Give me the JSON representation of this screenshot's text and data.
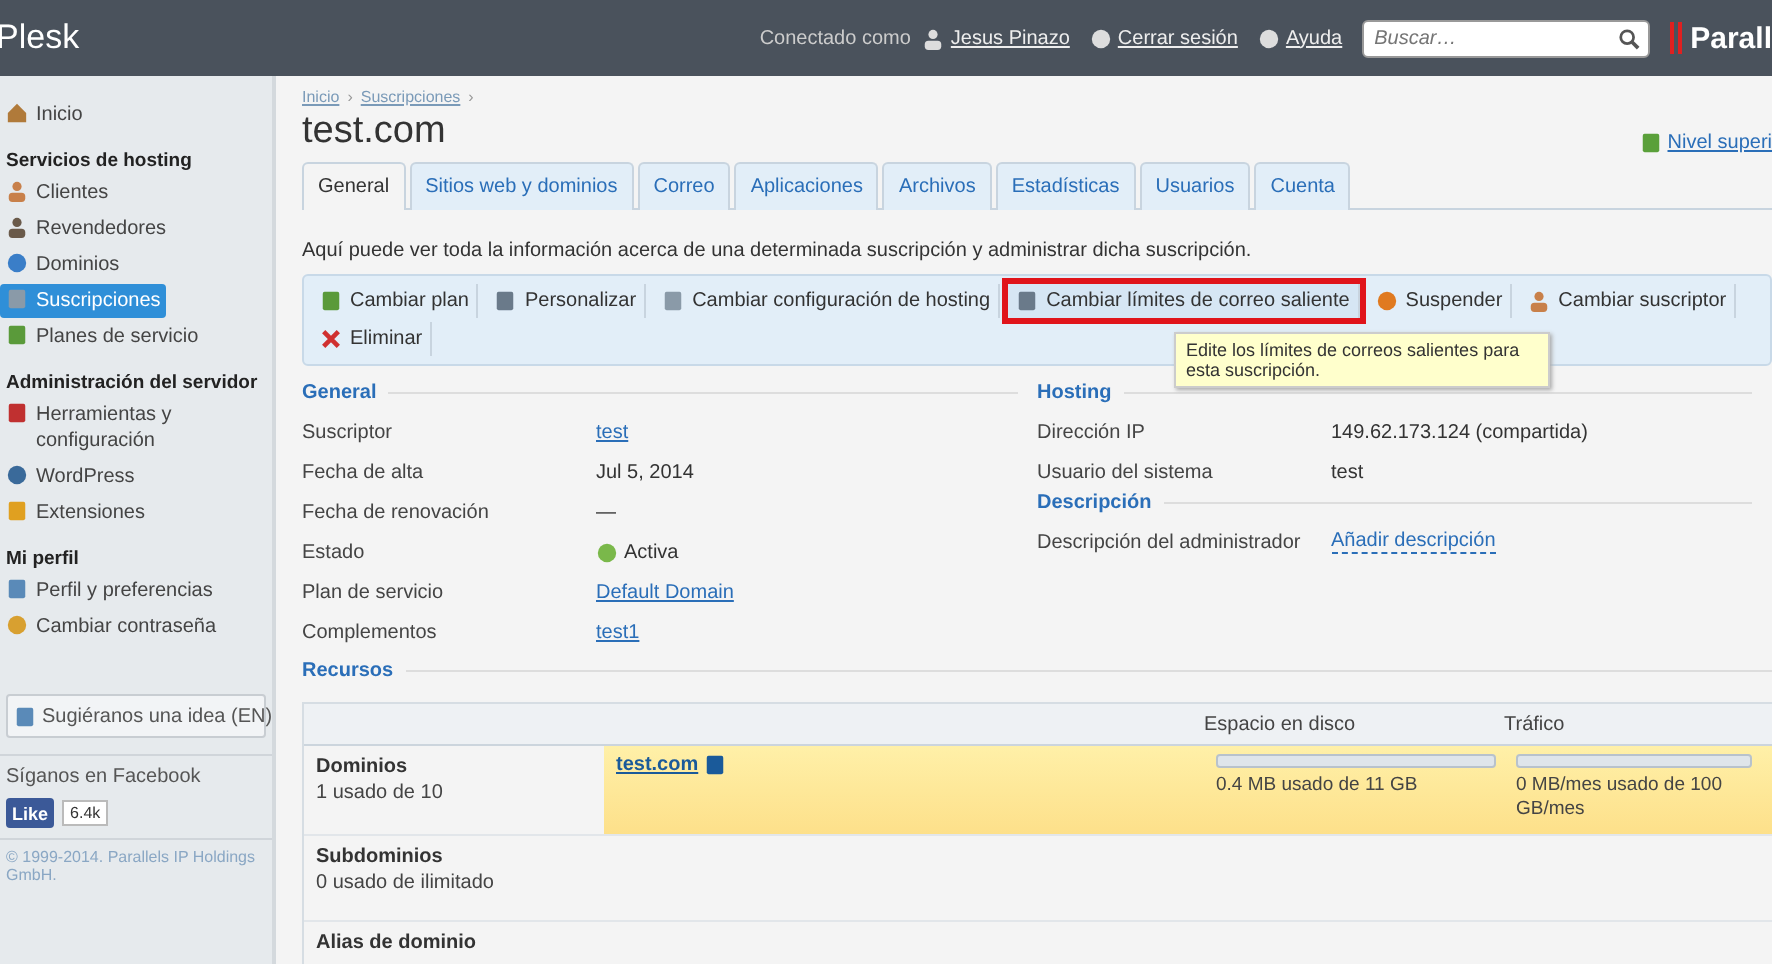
{
  "topbar": {
    "brand": "Plesk",
    "connected_label": "Conectado como",
    "user": "Jesus Pinazo",
    "logout": "Cerrar sesión",
    "help": "Ayuda",
    "search": {
      "placeholder": "Buscar…"
    },
    "logo": "Parall"
  },
  "sidebar": {
    "sections": [
      {
        "items": [
          {
            "label": "Inicio",
            "selected": false
          }
        ]
      },
      {
        "title": "Servicios de hosting",
        "items": [
          {
            "label": "Clientes",
            "selected": false
          },
          {
            "label": "Revendedores",
            "selected": false
          },
          {
            "label": "Dominios",
            "selected": false
          },
          {
            "label": "Suscripciones",
            "selected": true
          },
          {
            "label": "Planes de servicio",
            "selected": false
          }
        ]
      },
      {
        "title": "Administración del servidor",
        "items": [
          {
            "label": "Herramientas y configuración",
            "selected": false
          },
          {
            "label": "WordPress",
            "selected": false
          },
          {
            "label": "Extensiones",
            "selected": false
          }
        ]
      },
      {
        "title": "Mi perfil",
        "items": [
          {
            "label": "Perfil y preferencias",
            "selected": false
          },
          {
            "label": "Cambiar contraseña",
            "selected": false
          }
        ]
      }
    ],
    "idea_button": "Sugiéranos una idea (EN)",
    "facebook_label": "Síganos en Facebook",
    "like_button": "Like",
    "like_count": "6.4k",
    "copyright": "© 1999-2014. Parallels IP Holdings GmbH."
  },
  "breadcrumb": {
    "items": [
      "Inicio",
      "Suscripciones"
    ],
    "separator": "›"
  },
  "title": "test.com",
  "up_link": "Nivel superi",
  "tabs": [
    {
      "label": "General",
      "selected": true
    },
    {
      "label": "Sitios web y dominios",
      "selected": false
    },
    {
      "label": "Correo",
      "selected": false
    },
    {
      "label": "Aplicaciones",
      "selected": false
    },
    {
      "label": "Archivos",
      "selected": false
    },
    {
      "label": "Estadísticas",
      "selected": false
    },
    {
      "label": "Usuarios",
      "selected": false
    },
    {
      "label": "Cuenta",
      "selected": false
    }
  ],
  "intro": "Aquí puede ver toda la información acerca de una determinada suscripción y administrar dicha suscripción.",
  "toolbar": [
    {
      "label": "Cambiar plan",
      "highlighted": false
    },
    {
      "label": "Personalizar",
      "highlighted": false
    },
    {
      "label": "Cambiar configuración de hosting",
      "highlighted": false
    },
    {
      "label": "Cambiar límites de correo saliente",
      "highlighted": true
    },
    {
      "label": "Suspender",
      "highlighted": false
    },
    {
      "label": "Cambiar suscriptor",
      "highlighted": false
    },
    {
      "label": "Eliminar",
      "highlighted": false
    }
  ],
  "tooltip": "Edite los límites de correos salientes para esta suscripción.",
  "general": {
    "title": "General",
    "rows": [
      {
        "label": "Suscriptor",
        "value": "test",
        "kind": "link"
      },
      {
        "label": "Fecha de alta",
        "value": "Jul 5, 2014",
        "kind": "text"
      },
      {
        "label": "Fecha de renovación",
        "value": "—",
        "kind": "text"
      },
      {
        "label": "Estado",
        "value": "Activa",
        "kind": "status"
      },
      {
        "label": "Plan de servicio",
        "value": "Default Domain",
        "kind": "link"
      },
      {
        "label": "Complementos",
        "value": "test1",
        "kind": "link"
      }
    ]
  },
  "hosting": {
    "title": "Hosting",
    "rows": [
      {
        "label": "Dirección IP",
        "value": "149.62.173.124 (compartida)",
        "kind": "text"
      },
      {
        "label": "Usuario del sistema",
        "value": "test",
        "kind": "text"
      }
    ]
  },
  "descripcion": {
    "title": "Descripción",
    "rows": [
      {
        "label": "Descripción del administrador",
        "value": "Añadir descripción",
        "kind": "dashed-link"
      }
    ]
  },
  "resources": {
    "title": "Recursos",
    "columns": [
      "Espacio en disco",
      "Tráfico"
    ],
    "rows": [
      {
        "name": "Dominios",
        "usage": "1 usado de 10",
        "link": "test.com",
        "highlighted": true,
        "disk": {
          "level": 0.0,
          "text": "0.4 MB usado de 11 GB"
        },
        "traffic": {
          "level": 0.0,
          "text": "0 MB/mes usado de 100 GB/mes"
        }
      },
      {
        "name": "Subdominios",
        "usage": "0 usado de ilimitado",
        "highlighted": false
      },
      {
        "name": "Alias de dominio",
        "highlighted": false
      }
    ]
  }
}
